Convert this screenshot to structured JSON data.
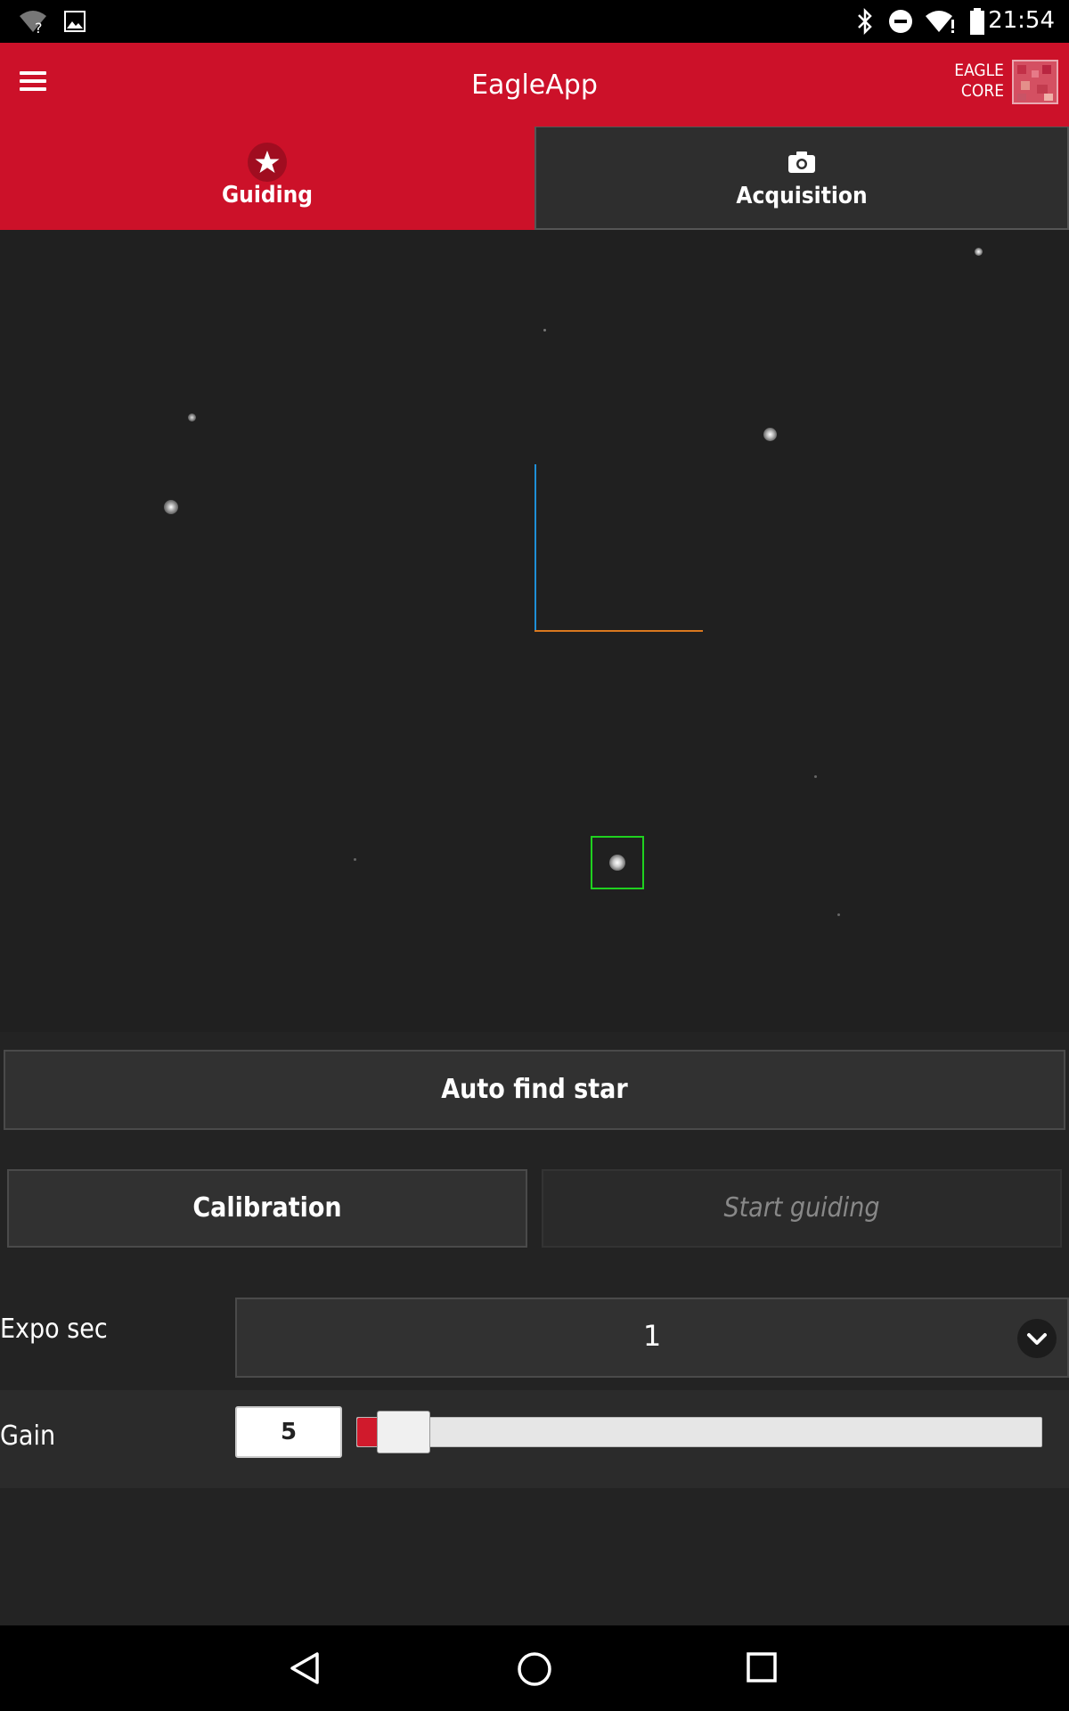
{
  "status_bar": {
    "time": "21:54",
    "icons": [
      "wifi-unknown-icon",
      "image-icon",
      "bluetooth-icon",
      "do-not-disturb-icon",
      "wifi-icon",
      "battery-icon"
    ]
  },
  "app_bar": {
    "title": "EagleApp",
    "brand_line1": "EAGLE",
    "brand_line2": "CORE"
  },
  "tabs": [
    {
      "label": "Guiding",
      "icon": "star-icon",
      "active": true
    },
    {
      "label": "Acquisition",
      "icon": "camera-icon",
      "active": false
    }
  ],
  "controls": {
    "auto_find_star": "Auto find star",
    "calibration": "Calibration",
    "start_guiding": "Start guiding",
    "expo_label": "Expo sec",
    "expo_value": "1",
    "gain_label": "Gain",
    "gain_value": "5",
    "gain_fraction": 0.02
  },
  "colors": {
    "accent": "#cc1129",
    "axis_y": "#1e8fd8",
    "axis_x": "#d9781f",
    "selection": "#1fd11f"
  }
}
